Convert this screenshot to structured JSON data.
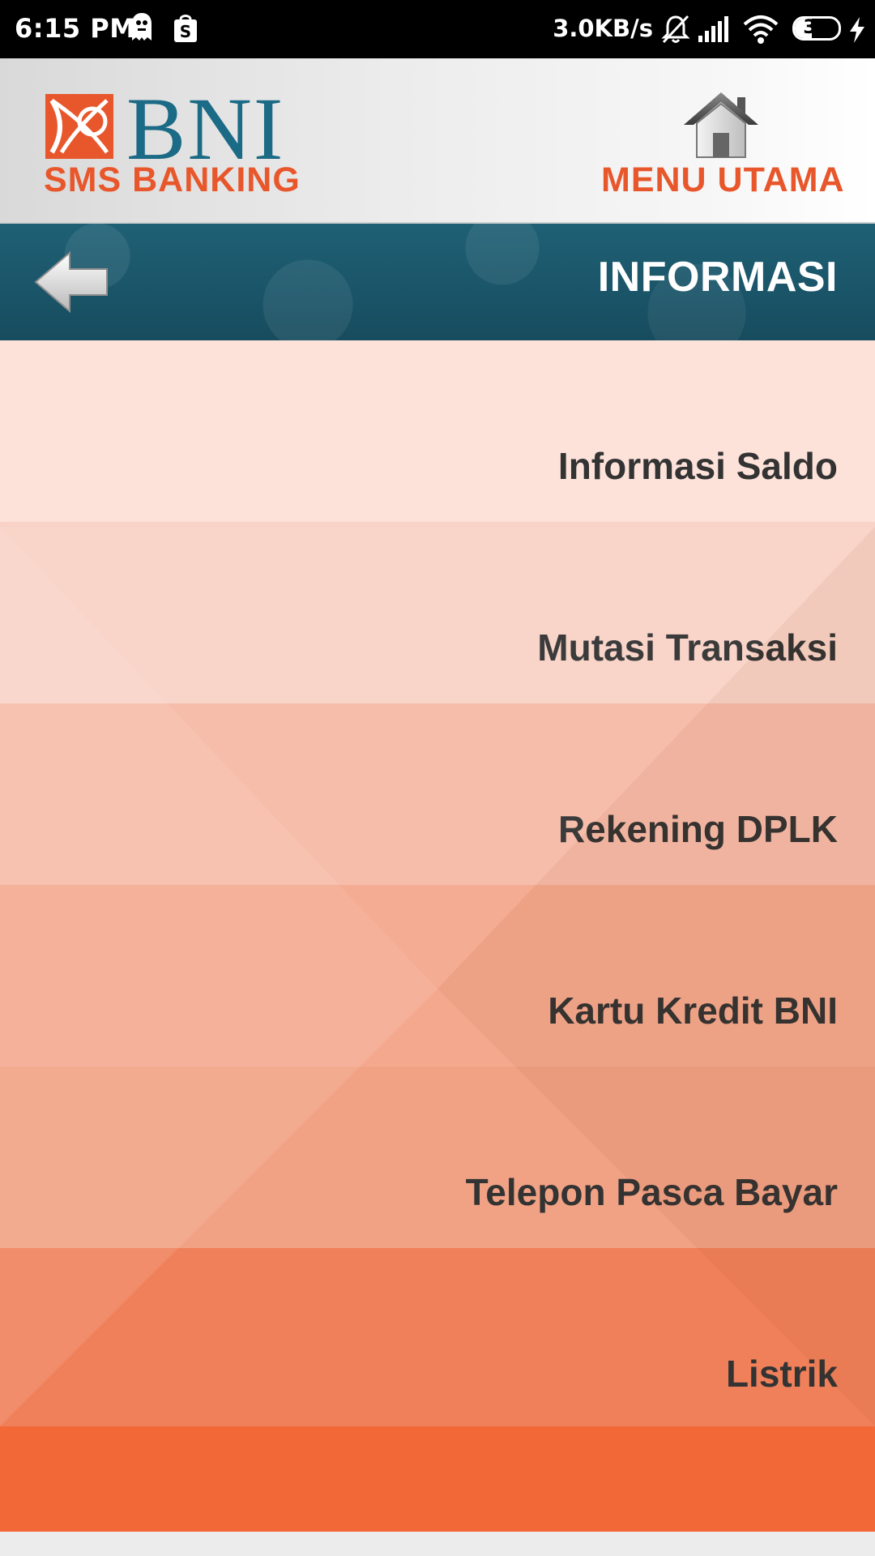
{
  "status_bar": {
    "time": "6:15 PM",
    "network_speed": "3.0KB/s",
    "battery_level": "38",
    "battery_fraction": 0.38,
    "icons": [
      "ghost-notification-icon",
      "shopping-bag-icon",
      "muted-bell-icon",
      "signal-icon",
      "wifi-icon",
      "battery-icon",
      "charging-icon"
    ]
  },
  "header": {
    "logo_brand": "BNI",
    "logo_subtitle": "SMS BANKING",
    "home_label": "MENU UTAMA"
  },
  "title_bar": {
    "title": "INFORMASI"
  },
  "menu": {
    "items": [
      {
        "label": "Informasi Saldo",
        "color": "#fde2da"
      },
      {
        "label": "Mutasi Transaksi",
        "color": "#f9d3c7"
      },
      {
        "label": "Rekening DPLK",
        "color": "#f6bba8"
      },
      {
        "label": "Kartu Kredit BNI",
        "color": "#f4a98e"
      },
      {
        "label": "Telepon Pasca Bayar",
        "color": "#f2a284"
      },
      {
        "label": "Listrik",
        "color": "#f0805a"
      }
    ],
    "bottom_color": "#f26837"
  },
  "colors": {
    "brand_blue": "#1b6a86",
    "brand_orange": "#e8572b",
    "title_bar": "#1b566a",
    "menu_text": "#333333"
  }
}
